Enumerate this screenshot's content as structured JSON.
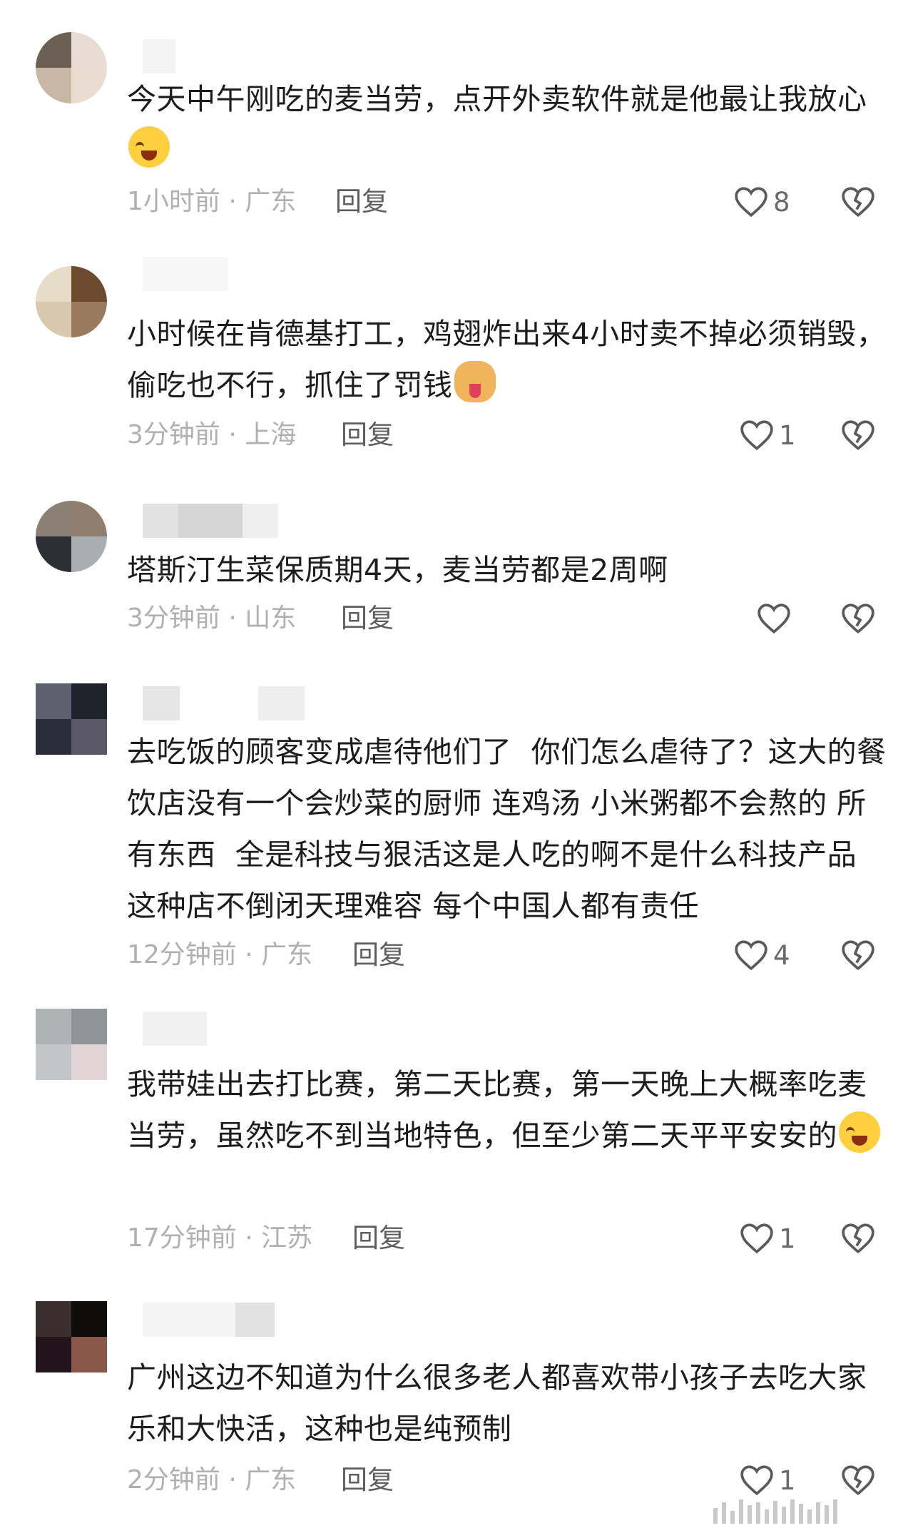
{
  "comments": [
    {
      "text": "今天中午刚吃的麦当劳，点开外卖软件就是他最让我放心",
      "emoji": "cry-emoji",
      "time_location": "1小时前 · 广东",
      "reply_label": "回复",
      "likes": "8"
    },
    {
      "text": "小时候在肯德基打工，鸡翅炸出来4小时卖不掉必须销毁，偷吃也不行，抓住了罚钱",
      "emoji": "dog-emoji",
      "time_location": "3分钟前 · 上海",
      "reply_label": "回复",
      "likes": "1"
    },
    {
      "text": "塔斯汀生菜保质期4天，麦当劳都是2周啊",
      "time_location": "3分钟前 · 山东",
      "reply_label": "回复",
      "likes": ""
    },
    {
      "text": "去吃饭的顾客变成虐待他们了  你们怎么虐待了？这大的餐饮店没有一个会炒菜的厨师 连鸡汤 小米粥都不会熬的 所有东西  全是科技与狠活这是人吃的啊不是什么科技产品   这种店不倒闭天理难容 每个中国人都有责任",
      "time_location": "12分钟前 · 广东",
      "reply_label": "回复",
      "likes": "4"
    },
    {
      "text": "我带娃出去打比赛，第二天比赛，第一天晚上大概率吃麦当劳，虽然吃不到当地特色，但至少第二天平平安安的",
      "emoji": "cry-emoji",
      "time_location": "17分钟前 · 江苏",
      "reply_label": "回复",
      "likes": "1"
    },
    {
      "text": "广州这边不知道为什么很多老人都喜欢带小孩子去吃大家乐和大快活，这种也是纯预制",
      "time_location": "2分钟前 · 广东",
      "reply_label": "回复",
      "likes": "1"
    }
  ],
  "colors": {
    "text": "#1d1d1d",
    "meta": "#b0b0b0",
    "icon": "#5a5a5a"
  }
}
